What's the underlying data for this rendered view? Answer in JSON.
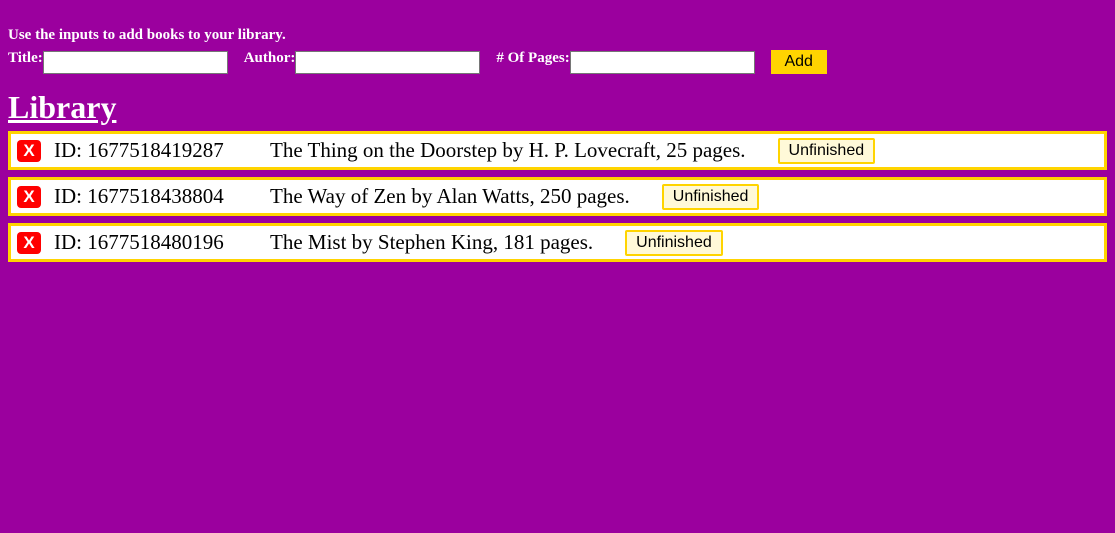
{
  "intro": "Use the inputs to add books to your library.",
  "form": {
    "title_label": "Title:",
    "author_label": "Author:",
    "pages_label": "# Of Pages:",
    "title_value": "",
    "author_value": "",
    "pages_value": "",
    "add_label": "Add"
  },
  "library": {
    "heading": "Library",
    "books": [
      {
        "delete_label": "X",
        "id": "ID: 1677518419287",
        "description": "The Thing on the Doorstep by H. P. Lovecraft, 25 pages.",
        "status": "Unfinished"
      },
      {
        "delete_label": "X",
        "id": "ID: 1677518438804",
        "description": "The Way of Zen by Alan Watts, 250 pages.",
        "status": "Unfinished"
      },
      {
        "delete_label": "X",
        "id": "ID: 1677518480196",
        "description": "The Mist by Stephen King, 181 pages.",
        "status": "Unfinished"
      }
    ]
  },
  "colors": {
    "background": "#9b009e",
    "accent": "#ffd400",
    "delete": "#ff0000",
    "row_background": "#ffffff"
  }
}
